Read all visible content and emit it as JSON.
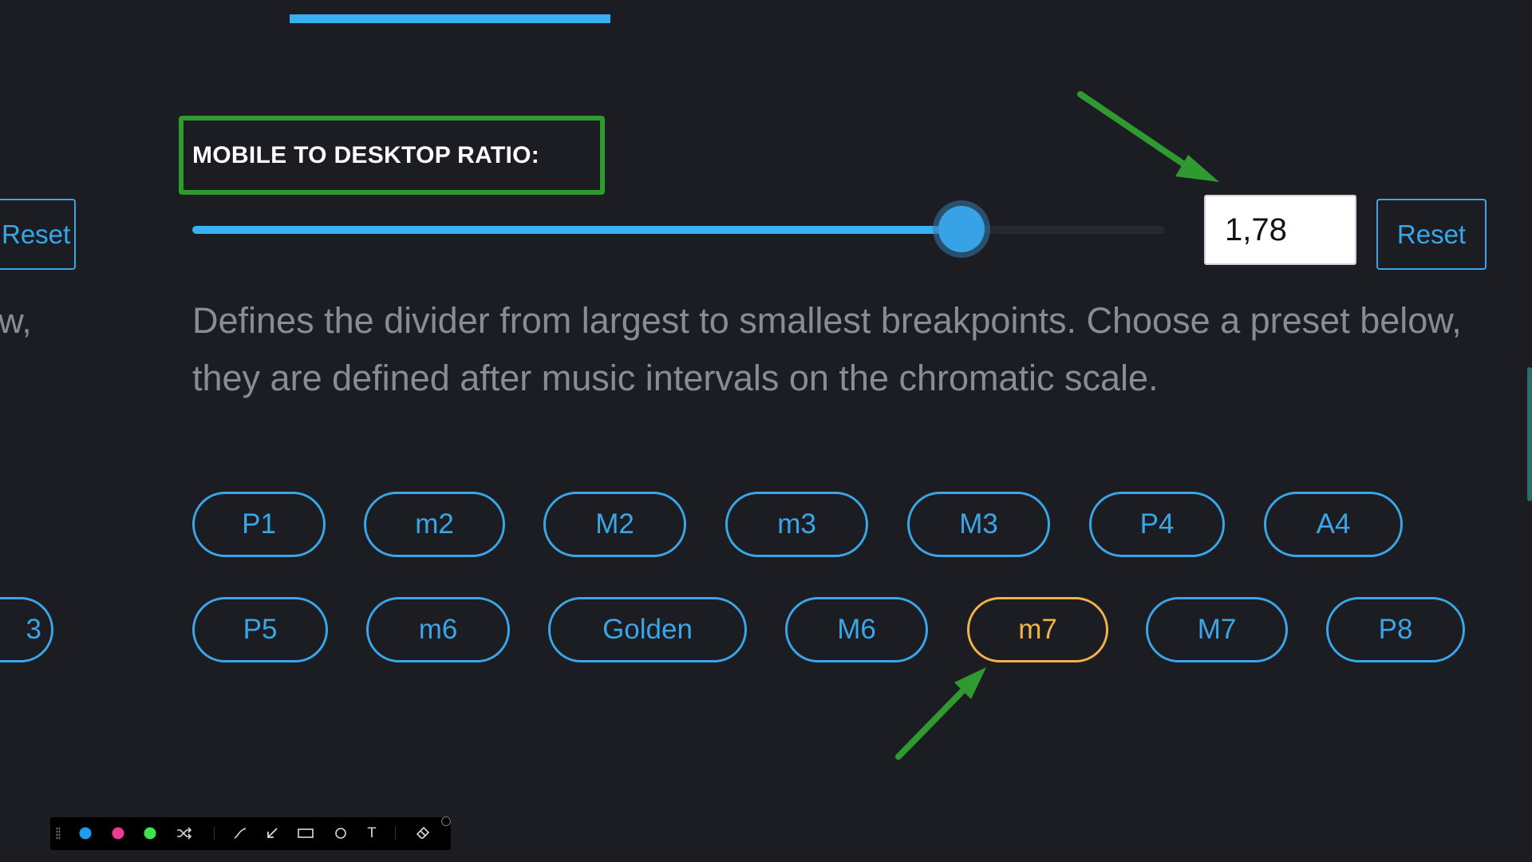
{
  "partial_left": {
    "reset_label": "Reset",
    "text_fragment": "w,",
    "pill_fragment": "3"
  },
  "ratio": {
    "label": "MOBILE TO DESKTOP RATIO:",
    "value": "1,78",
    "slider_fraction": 0.785,
    "reset_label": "Reset",
    "description": "Defines the divider from largest to smallest breakpoints. Choose a preset below, they are defined after music intervals on the chromatic scale."
  },
  "presets": {
    "row1": [
      "P1",
      "m2",
      "M2",
      "m3",
      "M3",
      "P4",
      "A4"
    ],
    "row2": [
      "P5",
      "m6",
      "Golden",
      "M6",
      "m7",
      "M7",
      "P8"
    ],
    "active": "m7"
  },
  "colors": {
    "background": "#1b1d22",
    "accent": "#38b0f2",
    "active_preset": "#f2b246",
    "annotation": "#2f9a2f"
  },
  "annotation_toolbar": {
    "colors": [
      "#1f9cf0",
      "#ea3d8f",
      "#3ee44d"
    ],
    "tools": [
      "shuffle-icon",
      "line-icon",
      "arrow-icon",
      "rectangle-icon",
      "ellipse-icon",
      "text-icon",
      "eraser-icon"
    ],
    "text_tool_glyph": "T"
  }
}
